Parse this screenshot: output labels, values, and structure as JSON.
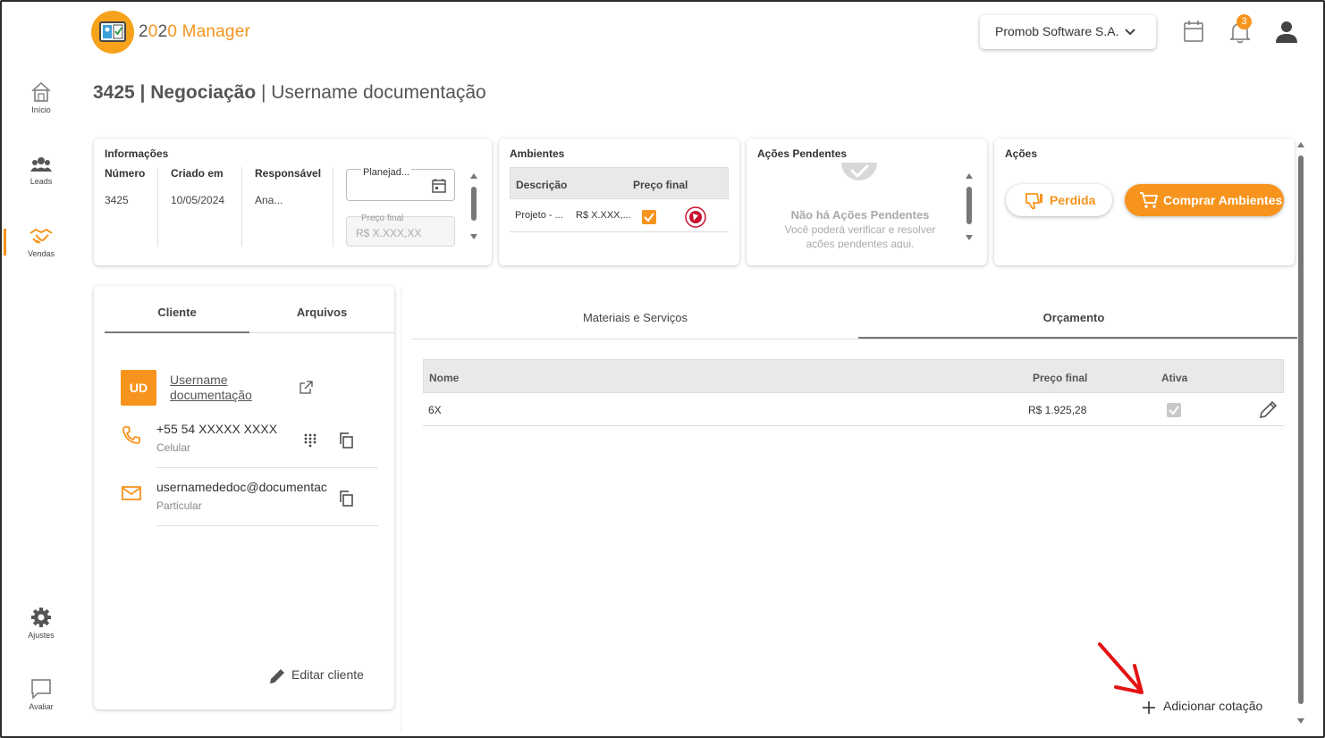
{
  "app": {
    "logo_text_a": "2",
    "logo_text_o1": "0",
    "logo_text_b": "2",
    "logo_text_o2": "0",
    "logo_text_c": " Manager",
    "brand_color": "#f7941d"
  },
  "sidebar": {
    "items": [
      {
        "label": "Início",
        "icon": "home-icon"
      },
      {
        "label": "Leads",
        "icon": "people-icon"
      },
      {
        "label": "Vendas",
        "icon": "handshake-icon",
        "active": true
      },
      {
        "label": "Ajustes",
        "icon": "gear-icon"
      },
      {
        "label": "Avaliar",
        "icon": "chat-icon"
      }
    ]
  },
  "header": {
    "company": "Promob Software S.A.",
    "notifications_count": "3"
  },
  "page": {
    "title_bold": "3425 | Negociação",
    "title_rest": " | Username documentação"
  },
  "informacoes": {
    "title": "Informações",
    "col_numero": "Número",
    "col_criado": "Criado em",
    "col_responsavel": "Responsável",
    "numero": "3425",
    "criado": "10/05/2024",
    "responsavel": "Ana...",
    "status_value": "Planejad...",
    "preco_label": "Preço final",
    "preco_value": "R$ X.XXX,XX"
  },
  "ambientes": {
    "title": "Ambientes",
    "col_descricao": "Descrição",
    "col_preco": "Preço final",
    "row_desc": "Projeto - ...",
    "row_preco": "R$ X.XXX,..."
  },
  "acoes_pendentes": {
    "title": "Ações Pendentes",
    "empty_title": "Não há Ações Pendentes",
    "empty_line1": "Você poderá verificar e resolver",
    "empty_line2": "ações pendentes aqui."
  },
  "acoes": {
    "title": "Ações",
    "perdida": "Perdida",
    "comprar": "Comprar Ambientes"
  },
  "cliente_panel": {
    "tab_cliente": "Cliente",
    "tab_arquivos": "Arquivos",
    "avatar": "UD",
    "name_line1": "Username",
    "name_line2": "documentação",
    "phone": "+55 54 XXXXX XXXX",
    "phone_type": "Celular",
    "email": "usernamededoc@documentac",
    "email_type": "Particular",
    "edit": "Editar cliente"
  },
  "orcamento_panel": {
    "tab_materiais": "Materiais e Serviços",
    "tab_orcamento": "Orçamento",
    "col_nome": "Nome",
    "col_preco": "Preço final",
    "col_ativa": "Ativa",
    "rows": [
      {
        "nome": "6X",
        "preco": "R$ 1.925,28",
        "ativa": true
      }
    ],
    "add": "Adicionar cotação"
  }
}
